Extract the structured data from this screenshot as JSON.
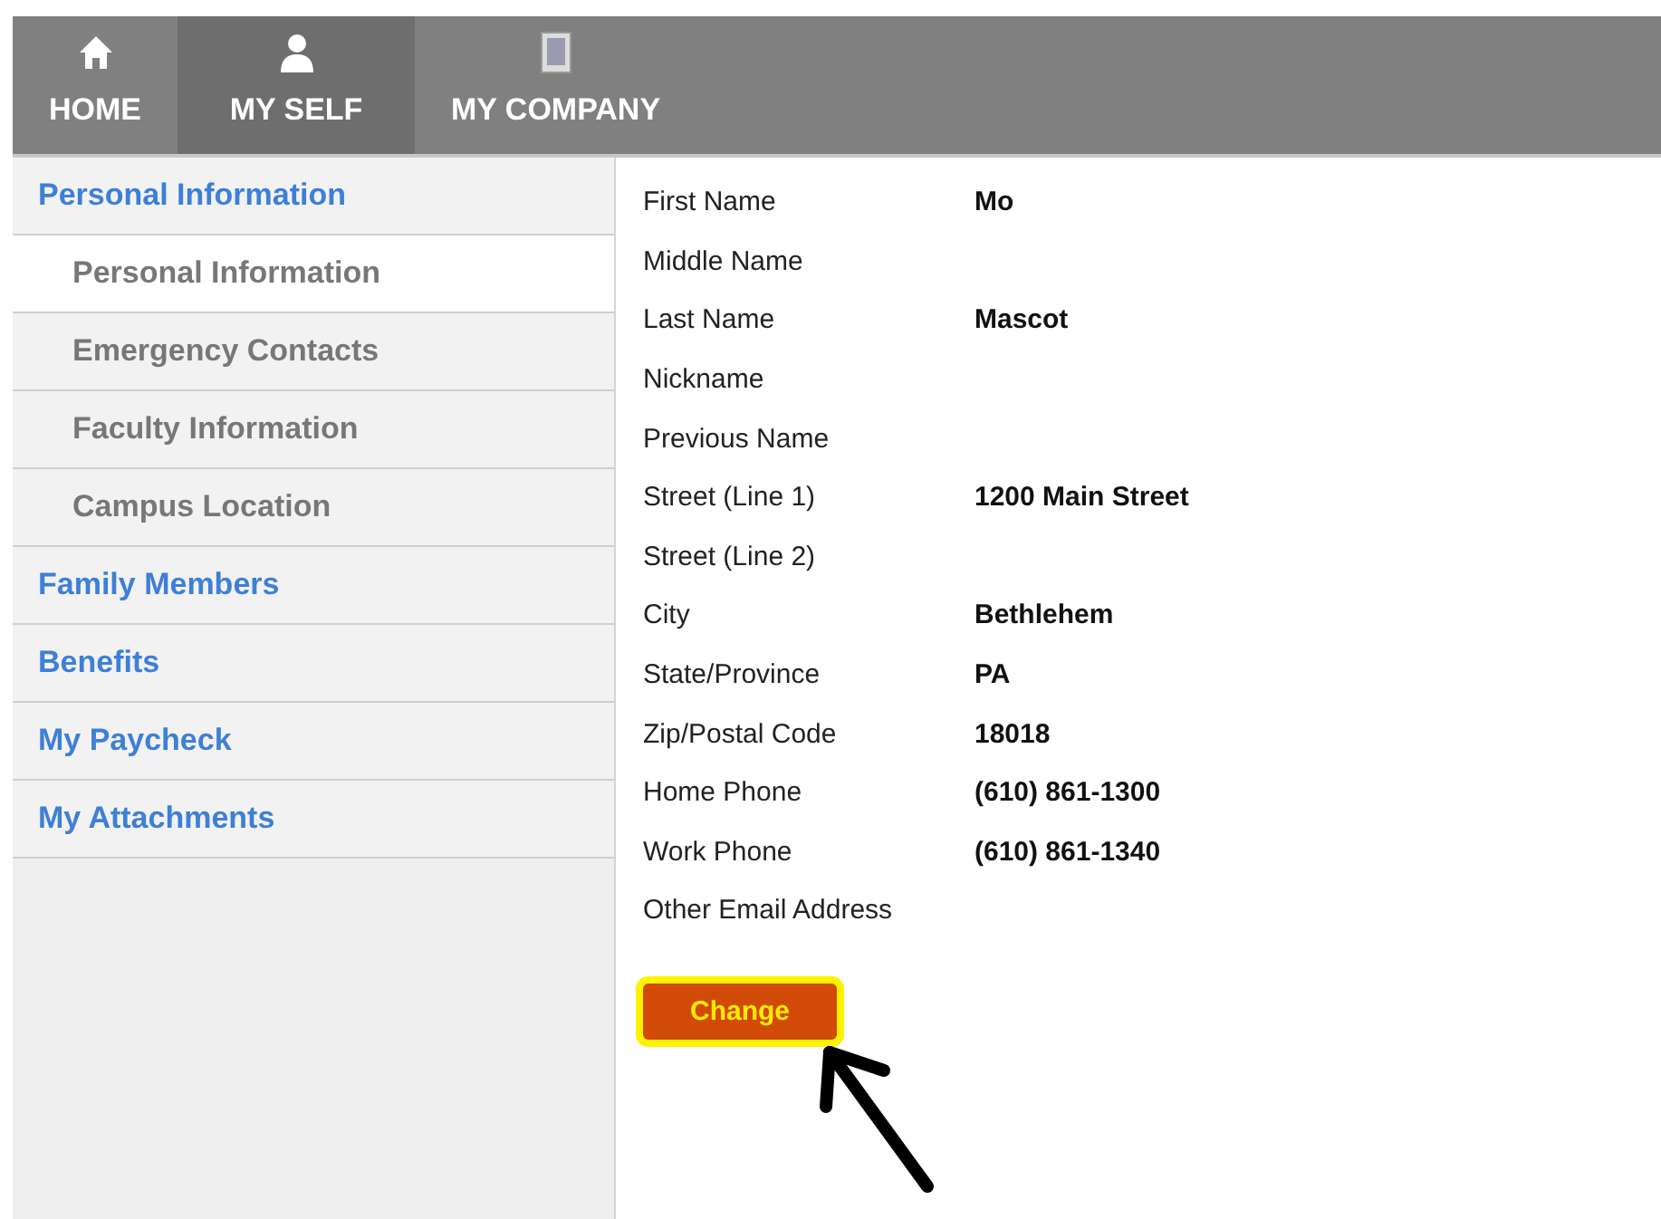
{
  "nav_tabs": [
    {
      "label": "HOME",
      "kind": "home",
      "selected": false
    },
    {
      "label": "MY SELF",
      "kind": "person",
      "selected": true
    },
    {
      "label": "MY COMPANY",
      "kind": "building",
      "selected": false
    }
  ],
  "sidebar": {
    "items": [
      {
        "label": "Personal Information",
        "children": [
          {
            "label": "Personal Information",
            "selected": true
          },
          {
            "label": "Emergency Contacts",
            "selected": false
          },
          {
            "label": "Faculty Information",
            "selected": false
          },
          {
            "label": "Campus Location",
            "selected": false
          }
        ]
      },
      {
        "label": "Family Members"
      },
      {
        "label": "Benefits"
      },
      {
        "label": "My Paycheck"
      },
      {
        "label": "My Attachments"
      }
    ]
  },
  "fields": [
    {
      "label": "First Name",
      "value": "Mo"
    },
    {
      "label": "Middle Name"
    },
    {
      "label": "Last Name",
      "value": "Mascot"
    },
    {
      "label": "Nickname"
    },
    {
      "label": "Previous Name"
    },
    {
      "label": "Street (Line 1)",
      "value": "1200 Main Street"
    },
    {
      "label": "Street (Line 2)"
    },
    {
      "label": "City",
      "value": "Bethlehem"
    },
    {
      "label": "State/Province",
      "value": "PA"
    },
    {
      "label": "Zip/Postal Code",
      "value": "18018"
    },
    {
      "label": "Home Phone",
      "value": "(610) 861-1300"
    },
    {
      "label": "Work Phone",
      "value": "(610) 861-1340"
    },
    {
      "label": "Other Email Address"
    }
  ],
  "change_button": {
    "label": "Change",
    "highlighted": true
  }
}
